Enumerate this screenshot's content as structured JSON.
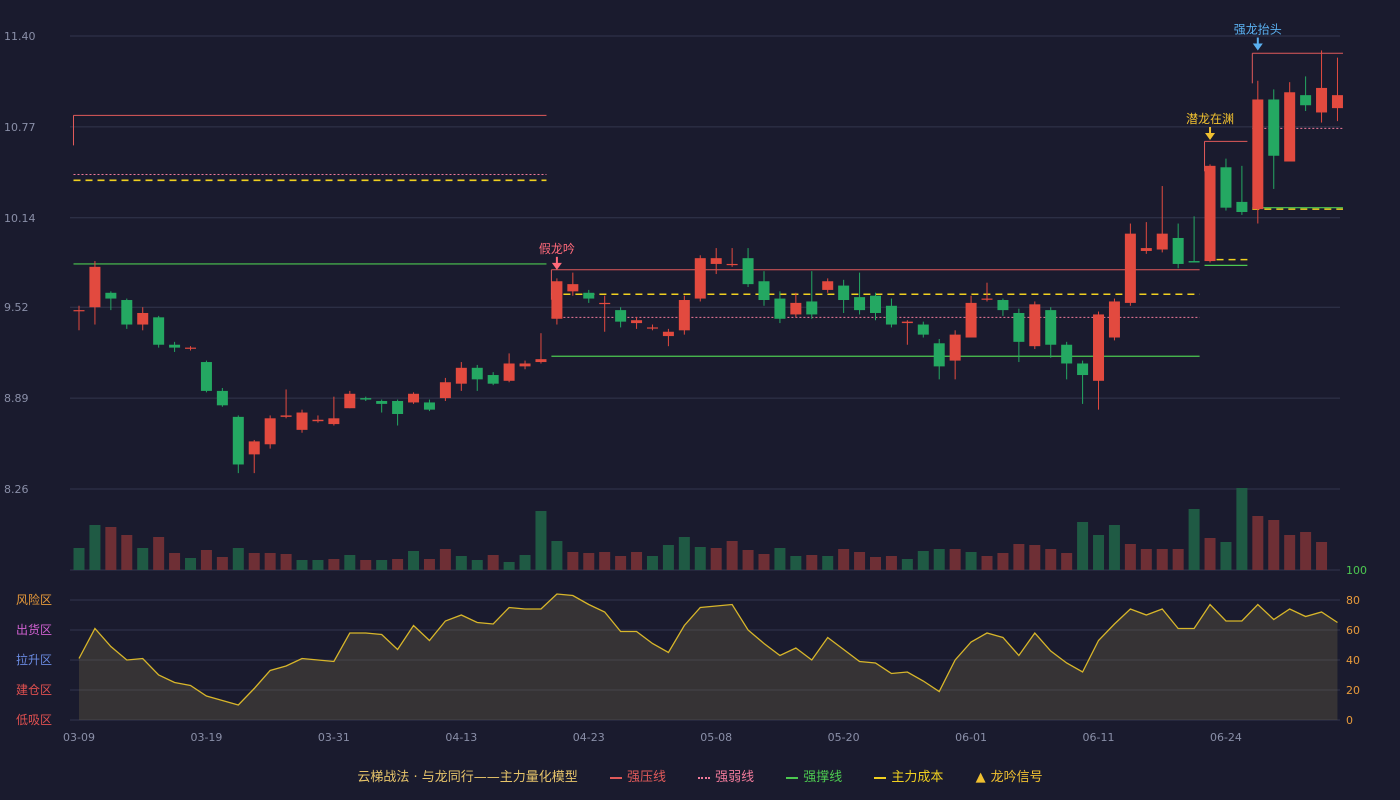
{
  "colors": {
    "up": "#e24a3f",
    "down": "#24a862",
    "upVol": "#6e2f35",
    "downVol": "#1f5a44",
    "press": "#e05a5a",
    "weak": "#f07a9a",
    "support": "#4cc850",
    "cost": "#f0d020",
    "signalYellow": "#f0c030",
    "signalBlue": "#5ab0f0",
    "signalRed": "#ff6a7a",
    "line": "#d8b62a",
    "area": "rgba(120,110,70,0.30)"
  },
  "legend": {
    "title": "云梯战法 · 与龙同行——主力量化模型",
    "items": [
      {
        "label": "强压线",
        "color": "#e05a5a",
        "style": "solid"
      },
      {
        "label": "强弱线",
        "color": "#f07a9a",
        "style": "dotted"
      },
      {
        "label": "强撑线",
        "color": "#4cc850",
        "style": "solid"
      },
      {
        "label": "主力成本",
        "color": "#f0d020",
        "style": "dashed"
      },
      {
        "label": "龙吟信号",
        "color": "#f0c030",
        "style": "triangle",
        "icon": "▲"
      }
    ]
  },
  "zones": [
    {
      "label": "风险区",
      "color": "#e89a3a"
    },
    {
      "label": "出货区",
      "color": "#d060d0"
    },
    {
      "label": "拉升区",
      "color": "#6a8ae0"
    },
    {
      "label": "建仓区",
      "color": "#e05050"
    },
    {
      "label": "低吸区",
      "color": "#e05050"
    }
  ],
  "chart_data": {
    "type": "candlestick",
    "xTicks": [
      {
        "i": 0,
        "label": "03-09"
      },
      {
        "i": 8,
        "label": "03-19"
      },
      {
        "i": 16,
        "label": "03-31"
      },
      {
        "i": 24,
        "label": "04-13"
      },
      {
        "i": 32,
        "label": "04-23"
      },
      {
        "i": 40,
        "label": "05-08"
      },
      {
        "i": 48,
        "label": "05-20"
      },
      {
        "i": 56,
        "label": "06-01"
      },
      {
        "i": 64,
        "label": "06-11"
      },
      {
        "i": 72,
        "label": "06-24"
      }
    ],
    "priceTicks": [
      11.4,
      10.77,
      10.14,
      9.52,
      8.89,
      8.26
    ],
    "priceRange": [
      8.26,
      11.4
    ],
    "indTicks": [
      100,
      80,
      60,
      40,
      20,
      0
    ],
    "candles": [
      [
        9.5,
        9.5,
        9.53,
        9.36
      ],
      [
        9.52,
        9.8,
        9.84,
        9.4
      ],
      [
        9.62,
        9.58,
        9.63,
        9.5
      ],
      [
        9.57,
        9.4,
        9.58,
        9.37
      ],
      [
        9.4,
        9.48,
        9.52,
        9.36
      ],
      [
        9.45,
        9.26,
        9.46,
        9.24
      ],
      [
        9.26,
        9.24,
        9.28,
        9.21
      ],
      [
        9.24,
        9.24,
        9.25,
        9.22
      ],
      [
        9.14,
        8.94,
        9.15,
        8.93
      ],
      [
        8.94,
        8.84,
        8.96,
        8.83
      ],
      [
        8.76,
        8.43,
        8.77,
        8.37
      ],
      [
        8.5,
        8.59,
        8.6,
        8.37
      ],
      [
        8.57,
        8.75,
        8.77,
        8.54
      ],
      [
        8.76,
        8.77,
        8.95,
        8.75
      ],
      [
        8.67,
        8.79,
        8.81,
        8.65
      ],
      [
        8.73,
        8.74,
        8.77,
        8.72
      ],
      [
        8.71,
        8.75,
        8.9,
        8.7
      ],
      [
        8.82,
        8.92,
        8.94,
        8.82
      ],
      [
        8.89,
        8.88,
        8.9,
        8.87
      ],
      [
        8.87,
        8.85,
        8.88,
        8.79
      ],
      [
        8.87,
        8.78,
        8.88,
        8.7
      ],
      [
        8.86,
        8.92,
        8.93,
        8.85
      ],
      [
        8.86,
        8.81,
        8.88,
        8.8
      ],
      [
        8.89,
        9.0,
        9.03,
        8.87
      ],
      [
        8.99,
        9.1,
        9.14,
        8.94
      ],
      [
        9.1,
        9.02,
        9.12,
        8.94
      ],
      [
        9.05,
        8.99,
        9.07,
        8.98
      ],
      [
        9.01,
        9.13,
        9.2,
        9.0
      ],
      [
        9.11,
        9.13,
        9.15,
        9.09
      ],
      [
        9.14,
        9.16,
        9.34,
        9.13
      ],
      [
        9.44,
        9.7,
        9.72,
        9.4
      ],
      [
        9.63,
        9.68,
        9.76,
        9.6
      ],
      [
        9.62,
        9.58,
        9.64,
        9.55
      ],
      [
        9.55,
        9.55,
        9.6,
        9.35
      ],
      [
        9.5,
        9.42,
        9.52,
        9.38
      ],
      [
        9.41,
        9.43,
        9.45,
        9.37
      ],
      [
        9.38,
        9.38,
        9.4,
        9.36
      ],
      [
        9.32,
        9.35,
        9.37,
        9.25
      ],
      [
        9.36,
        9.57,
        9.6,
        9.33
      ],
      [
        9.58,
        9.86,
        9.88,
        9.56
      ],
      [
        9.82,
        9.86,
        9.93,
        9.75
      ],
      [
        9.82,
        9.82,
        9.93,
        9.8
      ],
      [
        9.86,
        9.68,
        9.93,
        9.66
      ],
      [
        9.7,
        9.57,
        9.77,
        9.53
      ],
      [
        9.58,
        9.44,
        9.63,
        9.41
      ],
      [
        9.47,
        9.55,
        9.62,
        9.45
      ],
      [
        9.56,
        9.47,
        9.77,
        9.44
      ],
      [
        9.64,
        9.7,
        9.72,
        9.62
      ],
      [
        9.67,
        9.57,
        9.71,
        9.48
      ],
      [
        9.59,
        9.5,
        9.76,
        9.47
      ],
      [
        9.6,
        9.48,
        9.62,
        9.43
      ],
      [
        9.53,
        9.4,
        9.58,
        9.38
      ],
      [
        9.41,
        9.42,
        9.43,
        9.26
      ],
      [
        9.4,
        9.33,
        9.42,
        9.31
      ],
      [
        9.27,
        9.11,
        9.3,
        9.02
      ],
      [
        9.15,
        9.33,
        9.36,
        9.02
      ],
      [
        9.31,
        9.55,
        9.6,
        9.31
      ],
      [
        9.58,
        9.58,
        9.69,
        9.56
      ],
      [
        9.57,
        9.5,
        9.58,
        9.46
      ],
      [
        9.48,
        9.28,
        9.51,
        9.14
      ],
      [
        9.25,
        9.54,
        9.56,
        9.23
      ],
      [
        9.5,
        9.26,
        9.52,
        9.17
      ],
      [
        9.26,
        9.13,
        9.28,
        9.02
      ],
      [
        9.13,
        9.05,
        9.15,
        8.85
      ],
      [
        9.01,
        9.47,
        9.49,
        8.81
      ],
      [
        9.31,
        9.56,
        9.58,
        9.29
      ],
      [
        9.55,
        10.03,
        10.1,
        9.53
      ],
      [
        9.91,
        9.93,
        10.11,
        9.89
      ],
      [
        9.92,
        10.03,
        10.36,
        9.9
      ],
      [
        10.0,
        9.82,
        10.1,
        9.79
      ],
      [
        9.84,
        9.83,
        10.15,
        9.83
      ],
      [
        9.84,
        10.5,
        10.51,
        9.83
      ],
      [
        10.49,
        10.21,
        10.55,
        10.19
      ],
      [
        10.25,
        10.18,
        10.5,
        10.16
      ],
      [
        10.2,
        10.96,
        11.09,
        10.1
      ],
      [
        10.96,
        10.57,
        11.03,
        10.34
      ],
      [
        10.53,
        11.01,
        11.08,
        10.53
      ],
      [
        10.99,
        10.92,
        11.12,
        10.88
      ],
      [
        10.87,
        11.04,
        11.3,
        10.8
      ],
      [
        10.9,
        10.99,
        11.25,
        10.81
      ]
    ],
    "volumes": [
      22,
      45,
      43,
      35,
      22,
      33,
      17,
      12,
      20,
      13,
      22,
      17,
      17,
      16,
      10,
      10,
      11,
      15,
      10,
      10,
      11,
      19,
      11,
      21,
      14,
      10,
      15,
      8,
      15,
      59,
      29,
      18,
      17,
      18,
      14,
      18,
      14,
      25,
      33,
      23,
      22,
      29,
      20,
      16,
      22,
      14,
      15,
      14,
      21,
      18,
      13,
      14,
      11,
      19,
      21,
      21,
      18,
      14,
      17,
      26,
      25,
      21,
      17,
      48,
      35,
      45,
      26,
      21,
      21,
      21,
      61,
      32,
      28,
      82,
      54,
      50,
      35,
      38,
      28
    ],
    "volIsUp": [
      false,
      false,
      true,
      true,
      false,
      true,
      true,
      false,
      true,
      true,
      false,
      true,
      true,
      true,
      false,
      false,
      true,
      false,
      true,
      false,
      true,
      false,
      true,
      true,
      false,
      false,
      true,
      false,
      false,
      false,
      false,
      true,
      true,
      true,
      true,
      true,
      false,
      false,
      false,
      false,
      true,
      true,
      true,
      true,
      false,
      false,
      true,
      false,
      true,
      true,
      true,
      true,
      false,
      false,
      false,
      true,
      false,
      true,
      true,
      true,
      true,
      true,
      true,
      false,
      false,
      false,
      true,
      true,
      true,
      true,
      false,
      true,
      false,
      false,
      true,
      true,
      true,
      true,
      true
    ],
    "indicator": [
      41,
      61,
      49,
      40,
      41,
      30,
      25,
      23,
      16,
      13,
      10,
      21,
      33,
      36,
      41,
      40,
      39,
      58,
      58,
      57,
      47,
      63,
      53,
      66,
      70,
      65,
      64,
      75,
      74,
      74,
      84,
      83,
      77,
      72,
      59,
      59,
      51,
      45,
      63,
      75,
      76,
      77,
      60,
      51,
      43,
      48,
      40,
      55,
      47,
      39,
      38,
      31,
      32,
      26,
      19,
      40,
      52,
      58,
      55,
      43,
      58,
      46,
      38,
      32,
      53,
      64,
      74,
      70,
      74,
      61,
      61,
      77,
      66,
      66,
      77,
      67,
      74,
      69,
      72,
      65
    ],
    "levels": [
      {
        "name": "强压线",
        "style": "press",
        "from": 0,
        "to": 29,
        "value": 10.85
      },
      {
        "name": "强弱线",
        "style": "weak",
        "from": 0,
        "to": 29,
        "value": 10.44
      },
      {
        "name": "主力成本",
        "style": "cost",
        "from": 0,
        "to": 29,
        "value": 10.4
      },
      {
        "name": "强撑线",
        "style": "support",
        "from": 0,
        "to": 29,
        "value": 9.82
      },
      {
        "name": "强压线",
        "style": "press",
        "from": 30,
        "to": 70,
        "value": 9.78
      },
      {
        "name": "主力成本",
        "style": "cost",
        "from": 30,
        "to": 70,
        "value": 9.61
      },
      {
        "name": "强弱线",
        "style": "weak",
        "from": 30,
        "to": 70,
        "value": 9.45
      },
      {
        "name": "强撑线",
        "style": "support",
        "from": 30,
        "to": 70,
        "value": 9.18
      },
      {
        "name": "强压线",
        "style": "press",
        "from": 71,
        "to": 73,
        "value": 10.67
      },
      {
        "name": "主力成本",
        "style": "cost",
        "from": 71,
        "to": 73,
        "value": 9.85
      },
      {
        "name": "强撑线",
        "style": "support",
        "from": 71,
        "to": 73,
        "value": 9.81
      },
      {
        "name": "强压线",
        "style": "press",
        "from": 74,
        "to": 79,
        "value": 11.28
      },
      {
        "name": "强弱线",
        "style": "weak",
        "from": 74,
        "to": 79,
        "value": 10.76
      },
      {
        "name": "主力成本",
        "style": "cost",
        "from": 74,
        "to": 79,
        "value": 10.2
      },
      {
        "name": "强撑线",
        "style": "support",
        "from": 74,
        "to": 79,
        "value": 10.21
      }
    ],
    "signals": [
      {
        "i": 30,
        "label": "假龙吟",
        "value": 9.8,
        "color": "#ff6a7a"
      },
      {
        "i": 71,
        "label": "潜龙在渊",
        "value": 10.7,
        "color": "#f0c030"
      },
      {
        "i": 74,
        "label": "强龙抬头",
        "value": 11.32,
        "color": "#5ab0f0"
      }
    ]
  }
}
